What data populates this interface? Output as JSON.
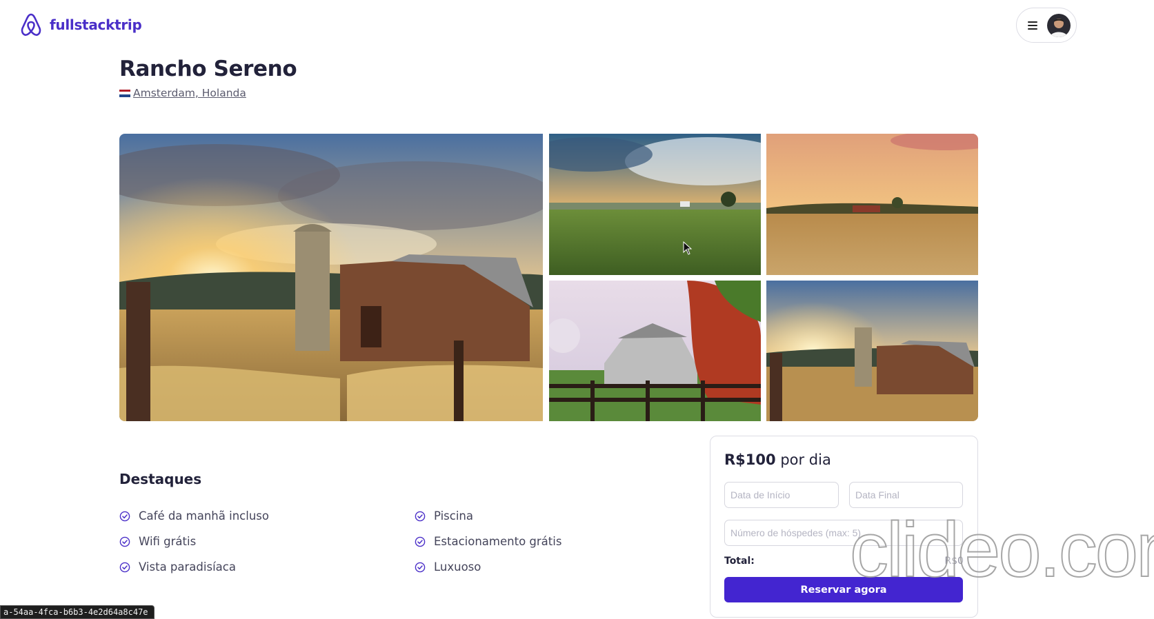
{
  "header": {
    "logo_text": "fullstacktrip",
    "logo_icon": "airbnb-style-logo-icon",
    "menu_icon": "hamburger-icon",
    "avatar": "user-avatar"
  },
  "property": {
    "title": "Rancho Sereno",
    "location": "Amsterdam, Holanda",
    "flag": "netherlands-flag-icon"
  },
  "gallery": {
    "photos": [
      "barn-silo-sunset",
      "green-field-clouds",
      "golden-prairie-farm",
      "white-barn-autumn-trees",
      "barn-silo-sunset-thumb"
    ]
  },
  "highlights": {
    "title": "Destaques",
    "items": [
      "Café da manhã incluso",
      "Piscina",
      "Wifi grátis",
      "Estacionamento grátis",
      "Vista paradisíaca",
      "Luxuoso"
    ],
    "icon": "check-circle-icon"
  },
  "booking": {
    "price_amount": "R$100",
    "price_unit": "por dia",
    "start_date_placeholder": "Data de Início",
    "end_date_placeholder": "Data Final",
    "guests_placeholder": "Número de hóspedes (max: 5)",
    "total_label": "Total:",
    "total_value": "R$0",
    "cta_label": "Reservar agora"
  },
  "overlays": {
    "status_url": "a-54aa-4fca-b6b3-4e2d64a8c47e",
    "watermark": "clideo.com"
  },
  "colors": {
    "brand": "#4a2fc8",
    "cta": "#4325d0",
    "text": "#22223a"
  }
}
